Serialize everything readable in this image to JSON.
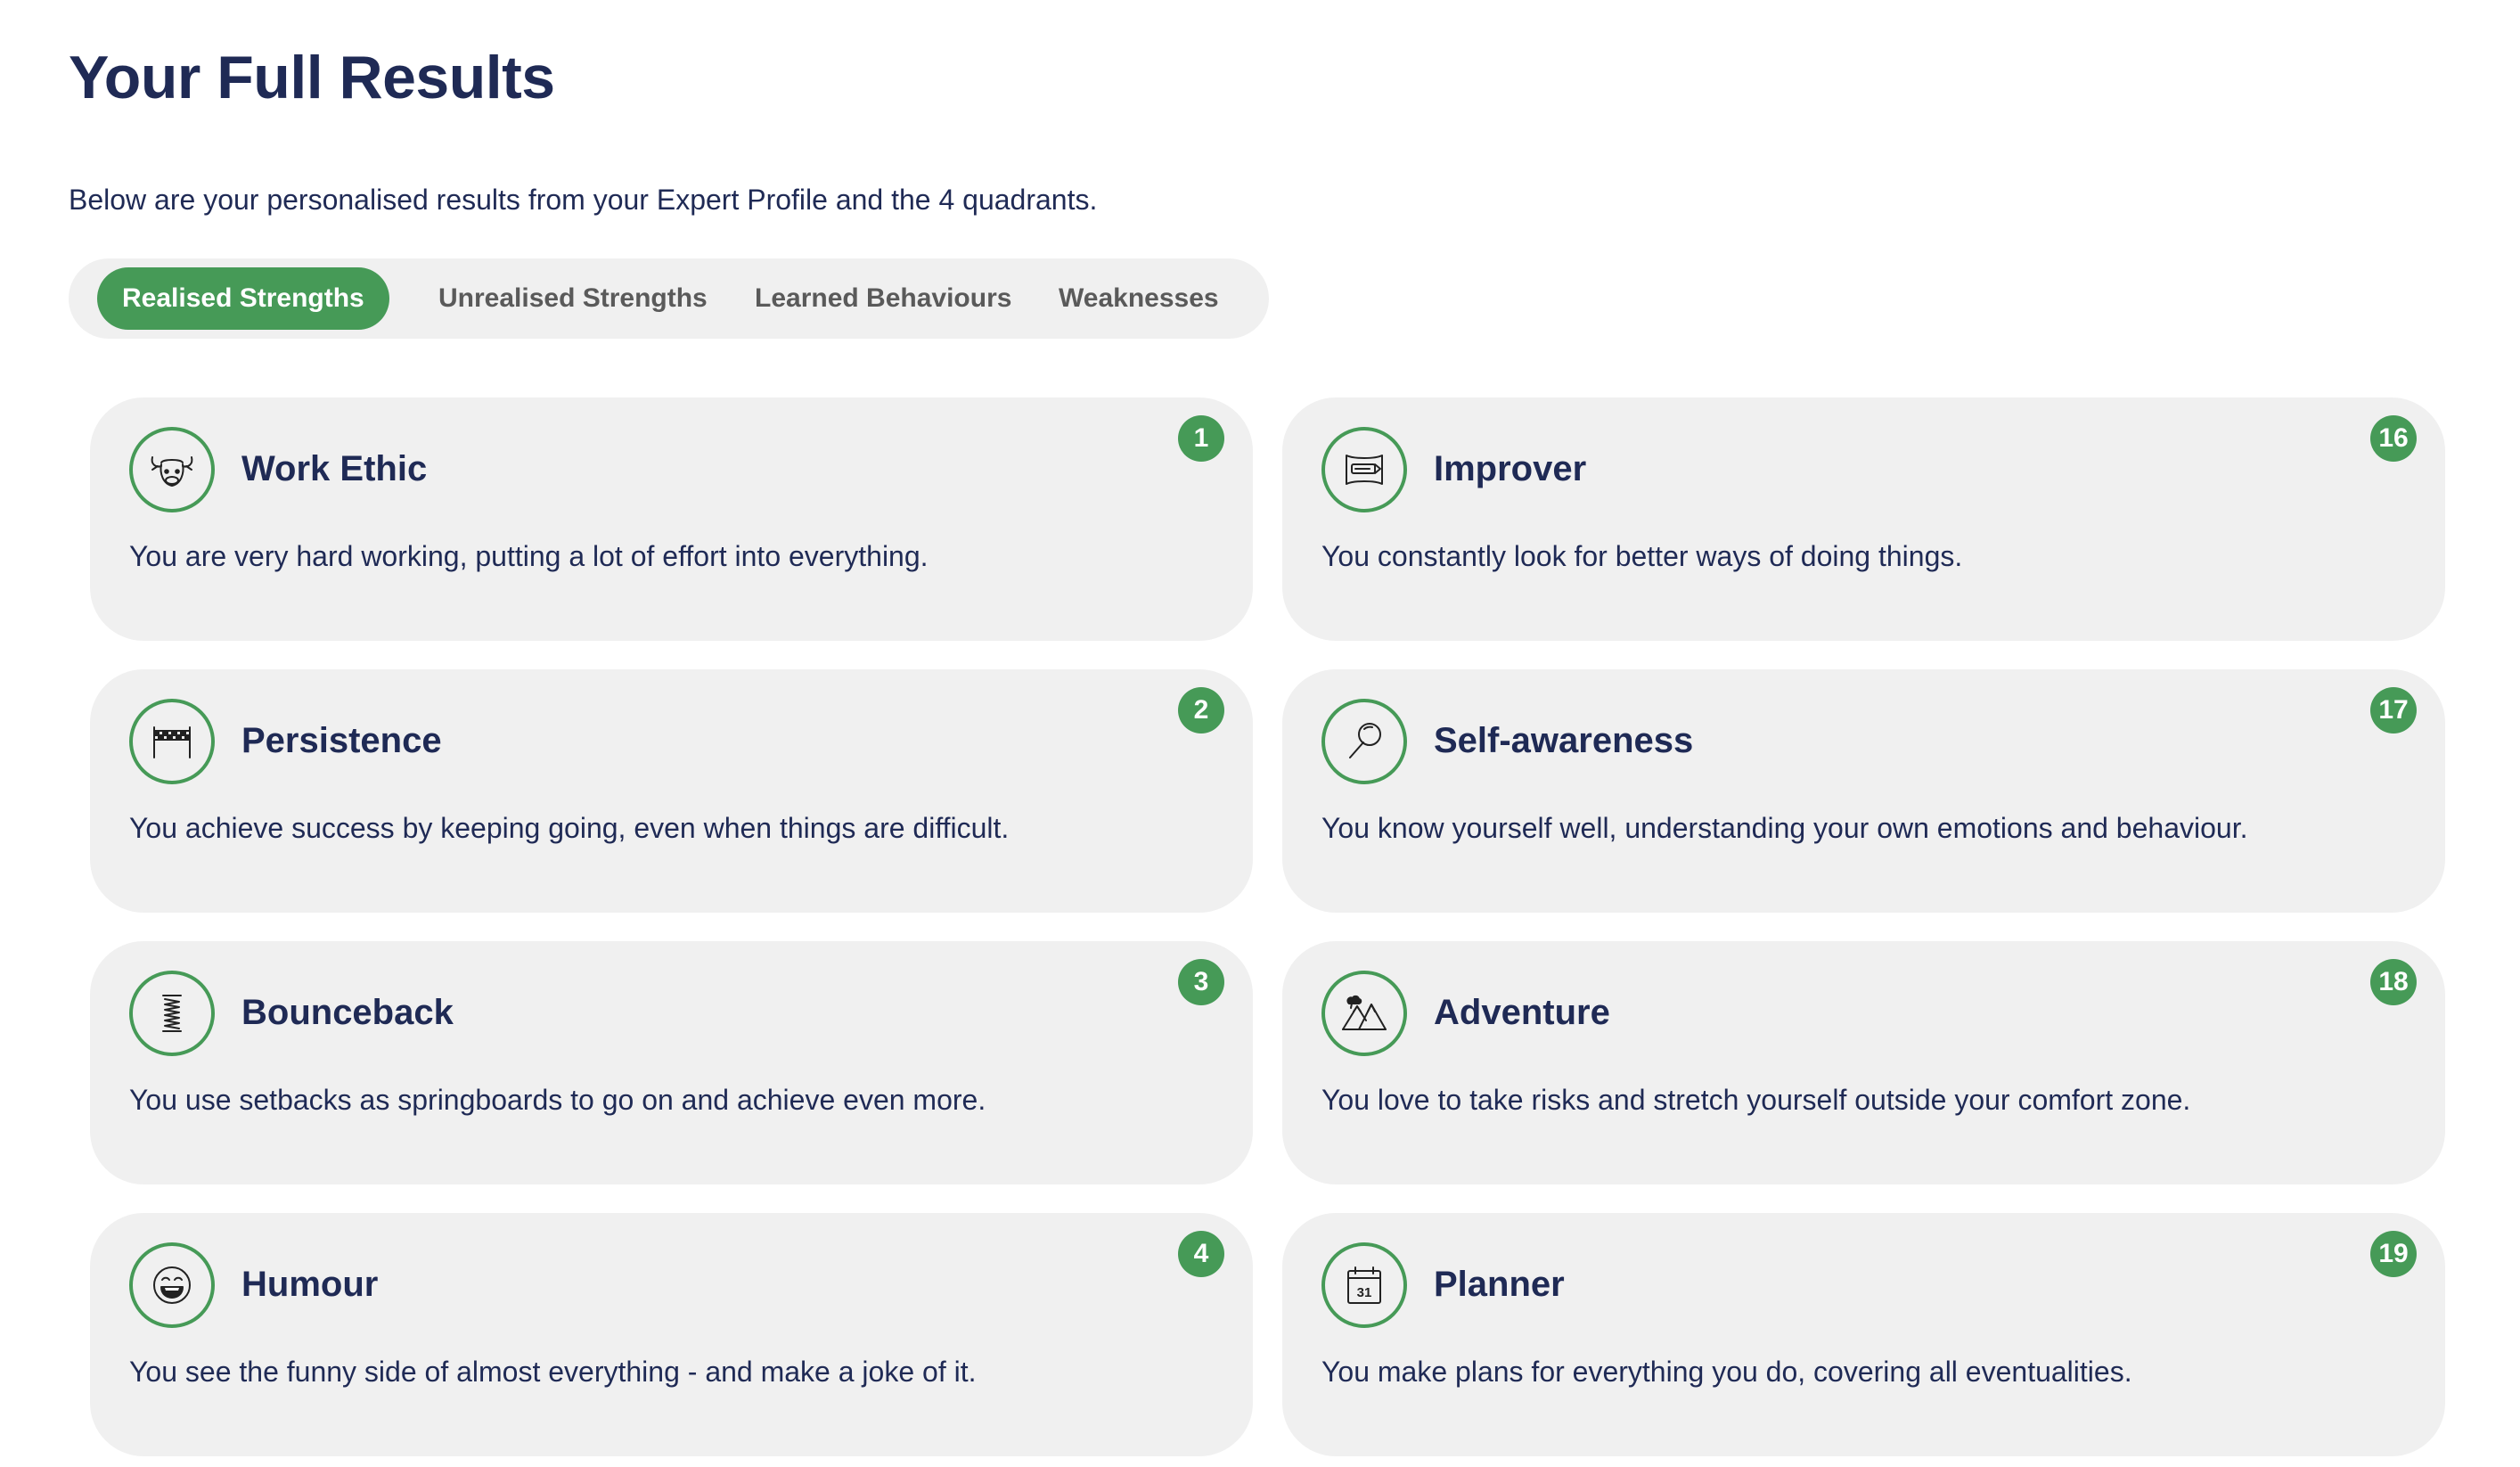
{
  "page": {
    "title": "Your Full Results",
    "intro": "Below are your personalised results from your Expert Profile and the 4 quadrants."
  },
  "tabs": [
    {
      "label": "Realised Strengths",
      "active": true
    },
    {
      "label": "Unrealised Strengths",
      "active": false
    },
    {
      "label": "Learned Behaviours",
      "active": false
    },
    {
      "label": "Weaknesses",
      "active": false
    }
  ],
  "colors": {
    "accent": "#469a57",
    "heading": "#1f2a55",
    "card_bg": "#f0f0f0"
  },
  "cards": [
    {
      "title": "Work Ethic",
      "description": "You are very hard working, putting a lot of effort into everything.",
      "rank": "1",
      "icon": "ox-icon"
    },
    {
      "title": "Improver",
      "description": "You constantly look for better ways of doing things.",
      "rank": "16",
      "icon": "sharpener-icon"
    },
    {
      "title": "Persistence",
      "description": "You achieve success by keeping going, even when things are difficult.",
      "rank": "2",
      "icon": "finish-line-icon"
    },
    {
      "title": "Self-awareness",
      "description": "You know yourself well, understanding your own emotions and behaviour.",
      "rank": "17",
      "icon": "magnifying-glass-icon"
    },
    {
      "title": "Bounceback",
      "description": "You use setbacks as springboards to go on and achieve even more.",
      "rank": "3",
      "icon": "spring-icon"
    },
    {
      "title": "Adventure",
      "description": "You love to take risks and stretch yourself outside your comfort zone.",
      "rank": "18",
      "icon": "mountains-icon"
    },
    {
      "title": "Humour",
      "description": "You see the funny side of almost everything - and make a joke of it.",
      "rank": "4",
      "icon": "laughing-face-icon"
    },
    {
      "title": "Planner",
      "description": "You make plans for everything you do, covering all eventualities.",
      "rank": "19",
      "icon": "calendar-icon"
    }
  ],
  "calendar_icon_text": "31"
}
